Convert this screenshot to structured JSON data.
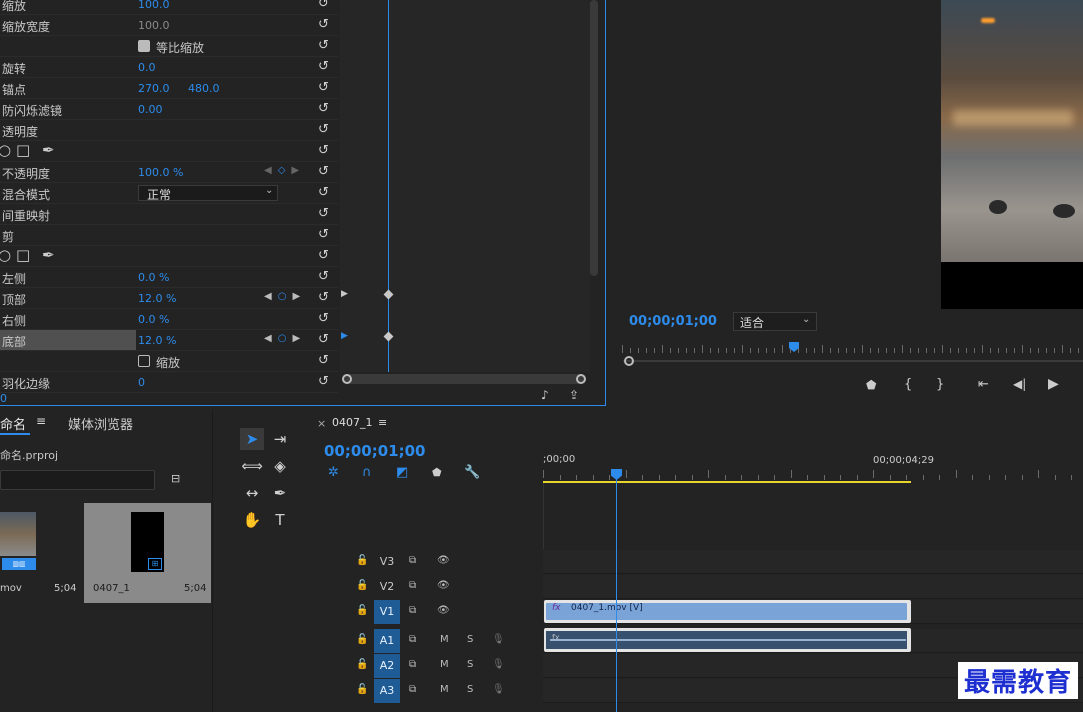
{
  "effect_controls": {
    "rows": [
      {
        "name": "缩放",
        "value": "100.0"
      },
      {
        "name": "缩放宽度",
        "value": "100.0",
        "dim": true
      },
      {
        "name": "",
        "checkbox_label": "等比缩放"
      },
      {
        "name": "旋转",
        "value": "0.0"
      },
      {
        "name": "锚点",
        "value": "270.0",
        "value2": "480.0"
      },
      {
        "name": "防闪烁滤镜",
        "value": "0.00"
      },
      {
        "name": "透明度"
      },
      {
        "name": "",
        "shape_tools": true
      },
      {
        "name": "不透明度",
        "value": "100.0 %"
      },
      {
        "name": "混合模式",
        "dropdown": "正常"
      },
      {
        "name": "间重映射"
      },
      {
        "name": "剪"
      },
      {
        "name": "",
        "shape_tools": true
      },
      {
        "name": "左侧",
        "value": "0.0 %"
      },
      {
        "name": "顶部",
        "value": "12.0 %"
      },
      {
        "name": "右侧",
        "value": "0.0 %"
      },
      {
        "name": "底部",
        "value": "12.0 %"
      },
      {
        "name": "",
        "checkbox_label": "缩放"
      },
      {
        "name": "羽化边缘",
        "value": "0"
      }
    ],
    "footer_value": "0"
  },
  "program_monitor": {
    "timecode": "00;00;01;00",
    "fit_label": "适合"
  },
  "project": {
    "tab_label": "命名",
    "tab2_label": "媒体浏览器",
    "file_name": "命名.prproj",
    "items": [
      {
        "name": "mov",
        "duration": "5;04"
      },
      {
        "name": "0407_1",
        "duration": "5;04"
      }
    ]
  },
  "timeline": {
    "sequence_tab": "0407_1",
    "timecode": "00;00;01;00",
    "ruler_start": ";00;00",
    "ruler_end": "00;00;04;29",
    "tracks": [
      "V3",
      "V2",
      "V1",
      "A1",
      "A2",
      "A3"
    ],
    "clip_label": "0407_1.mov [V]",
    "mute_label": "M",
    "solo_label": "S"
  },
  "watermark": "最需教育"
}
